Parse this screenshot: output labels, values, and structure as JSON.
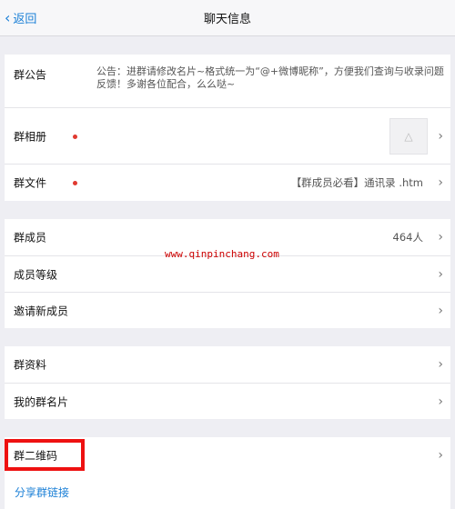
{
  "navbar": {
    "back_label": "返回",
    "title": "聊天信息"
  },
  "group_info": {
    "notice_label": "群公告",
    "notice_text": "公告：进群请修改名片~格式统一为“@+微博昵称”，方便我们查询与收录问题反馈！多谢各位配合，么么哒~",
    "album_label": "群相册",
    "files_label": "群文件",
    "files_value": "【群成员必看】通讯录 .htm"
  },
  "members": {
    "members_label": "群成员",
    "members_count": "464人",
    "level_label": "成员等级",
    "invite_label": "邀请新成员"
  },
  "profile": {
    "data_label": "群资料",
    "card_label": "我的群名片"
  },
  "share": {
    "qrcode_label": "群二维码",
    "link_label": "分享群链接"
  },
  "watermark": "www.qinpinchang.com",
  "colors": {
    "accent": "#1a7fd6",
    "highlight": "#e11111",
    "dot": "#e03a30"
  }
}
